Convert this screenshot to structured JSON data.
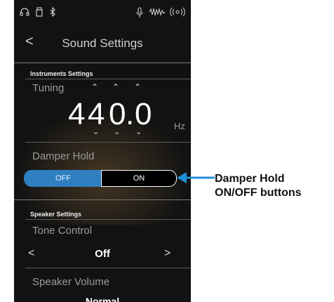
{
  "status_bar": {
    "icons": [
      "headphones-icon",
      "usb-stick-icon",
      "bluetooth-icon",
      "microphone-icon",
      "audio-wave-icon",
      "wireless-icon"
    ]
  },
  "header": {
    "back_icon": "chevron-left-icon",
    "back_glyph": "<",
    "title": "Sound Settings"
  },
  "instruments_settings": {
    "heading": "Instruments Settings",
    "tuning": {
      "label": "Tuning",
      "digits": [
        "4",
        "4",
        "0",
        ".",
        "0"
      ],
      "unit": "Hz",
      "up_glyph": "^",
      "down_glyph": "v"
    },
    "damper_hold": {
      "label": "Damper Hold",
      "off_label": "OFF",
      "on_label": "ON",
      "selected": "OFF"
    }
  },
  "speaker_settings": {
    "heading": "Speaker Settings",
    "tone_control": {
      "label": "Tone Control",
      "value": "Off",
      "prev_glyph": "<",
      "next_glyph": ">"
    },
    "speaker_volume": {
      "label": "Speaker Volume",
      "value": "Normal"
    }
  },
  "annotation": {
    "line1": "Damper Hold",
    "line2": "ON/OFF buttons",
    "color": "#1f8fd6"
  },
  "colors": {
    "accent": "#2f7fc1",
    "background": "#121212"
  }
}
